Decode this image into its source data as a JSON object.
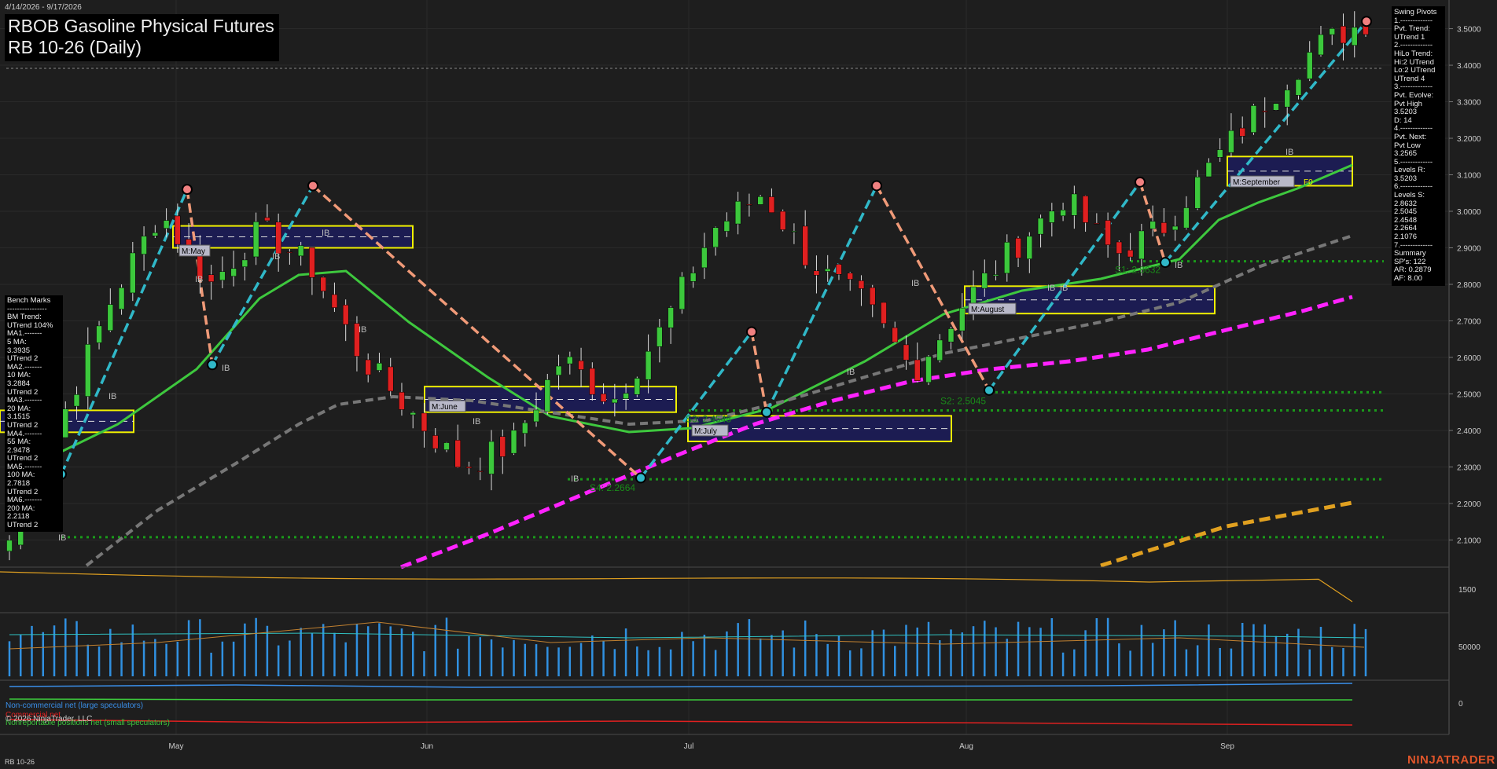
{
  "header": {
    "date_range": "4/14/2026 - 9/17/2026",
    "title_line1": "RBOB Gasoline Physical Futures",
    "title_line2": "RB 10-26 (Daily)"
  },
  "colors": {
    "background": "#1e1e1e",
    "candle_up": "#3cc83c",
    "candle_down": "#e02020",
    "ma_green": "#3ec83e",
    "ma_gray": "#7a7a7a",
    "ma_magenta": "#ff22ff",
    "ma_orange": "#e0a020",
    "swing_up": "#30b8c8",
    "swing_down": "#f09a78",
    "zone_border": "#f0f000",
    "zone_fill": "#1c1c5c",
    "volume": "#3090e0",
    "brand": "#e0552a"
  },
  "bench_marks": [
    "Bench Marks",
    "----------------",
    "BM Trend:",
    "UTrend 104%",
    "MA1.-------",
    "5 MA:",
    "3.3935",
    "UTrend 2",
    "MA2.-------",
    "10 MA:",
    "3.2884",
    "UTrend 2",
    "MA3.-------",
    "20 MA:",
    "3.1515",
    "UTrend 2",
    "MA4.-------",
    "55 MA:",
    "2.9478",
    "UTrend 2",
    "MA5.-------",
    "100 MA:",
    "2.7818",
    "UTrend 2",
    "MA6.-------",
    "200 MA:",
    "2.2118",
    "UTrend 2"
  ],
  "swing_pivots": [
    "Swing Pivots",
    "1.-------------",
    "Pvt. Trend:",
    "UTrend 1",
    "2.-------------",
    "HiLo Trend:",
    "Hi:2 UTrend",
    "Lo:2 UTrend",
    "UTrend 4",
    "3.-------------",
    "Pvt. Evolve:",
    "Pvt High",
    "3.5203",
    "D: 14",
    "4.-------------",
    "Pvt. Next:",
    "Pvt Low",
    "3.2565",
    "5.-------------",
    "Levels R:",
    "3.5203",
    "6.-------------",
    "Levels S:",
    "2.8632",
    "2.5045",
    "2.4548",
    "2.2664",
    "2.1076",
    "7.-------------",
    "Summary",
    "SP's: 122",
    "AR: 0.2879",
    "AF: 8.00"
  ],
  "price_axis": [
    "3.5000",
    "3.4000",
    "3.3000",
    "3.2000",
    "3.1000",
    "3.0000",
    "2.9000",
    "2.8000",
    "2.7000",
    "2.6000",
    "2.5000",
    "2.4000",
    "2.3000",
    "2.2000",
    "2.1000"
  ],
  "panel2_axis": [
    "1500"
  ],
  "panel3_axis": [
    "50000"
  ],
  "panel4_axis": [
    "0"
  ],
  "month_labels": [
    "May",
    "Jun",
    "Jul",
    "Aug",
    "Sep"
  ],
  "month_zones": [
    "M:May",
    "M:June",
    "M:July",
    "M:August",
    "M:September"
  ],
  "zone_tags": [
    "F0"
  ],
  "support_labels": [
    "S1: 2.8632",
    "S2: 2.5045",
    "S3: 2.4548",
    "S4: 2.2664"
  ],
  "ib_label": "IB",
  "legend": {
    "noncommercial": "Non-commercial net (large speculators)",
    "commercial": "Commercial net",
    "copyright": "© 2026 NinjaTrader, LLC",
    "nonreportable": "Nonreportable positions net (small speculators)"
  },
  "instrument_footer": "RB 10-26",
  "brand": "NINJATRADER",
  "chart_data": {
    "type": "candlestick",
    "title": "RBOB Gasoline Physical Futures",
    "subtitle": "RB 10-26 (Daily)",
    "ylim": [
      2.03,
      3.57
    ],
    "x_range": [
      "2026-04-14",
      "2026-09-17"
    ],
    "resistance_levels": [
      3.5203
    ],
    "support_levels": [
      2.8632,
      2.5045,
      2.4548,
      2.2664,
      2.1076
    ],
    "moving_averages": [
      {
        "name": "5 MA",
        "value": 3.3935
      },
      {
        "name": "10 MA",
        "value": 3.2884
      },
      {
        "name": "20 MA",
        "value": 3.1515
      },
      {
        "name": "55 MA",
        "value": 2.9478
      },
      {
        "name": "100 MA",
        "value": 2.7818
      },
      {
        "name": "200 MA",
        "value": 2.2118
      }
    ],
    "swing_pivots": [
      {
        "type": "low",
        "value": 2.28
      },
      {
        "type": "high",
        "value": 3.06
      },
      {
        "type": "low",
        "value": 2.58
      },
      {
        "type": "high",
        "value": 3.07
      },
      {
        "type": "low",
        "value": 2.27
      },
      {
        "type": "high",
        "value": 2.67
      },
      {
        "type": "low",
        "value": 2.45
      },
      {
        "type": "high",
        "value": 3.07
      },
      {
        "type": "low",
        "value": 2.51
      },
      {
        "type": "high",
        "value": 3.08
      },
      {
        "type": "low",
        "value": 2.86
      },
      {
        "type": "high",
        "value": 3.52
      }
    ],
    "anchors": [
      2.1,
      2.42,
      2.75,
      3.0,
      2.8,
      2.95,
      2.85,
      2.6,
      2.45,
      2.3,
      2.36,
      2.6,
      2.48,
      2.68,
      2.95,
      3.05,
      2.85,
      2.75,
      2.56,
      2.75,
      2.9,
      3.04,
      2.88,
      2.96,
      3.14,
      3.3,
      3.45,
      3.52
    ]
  }
}
